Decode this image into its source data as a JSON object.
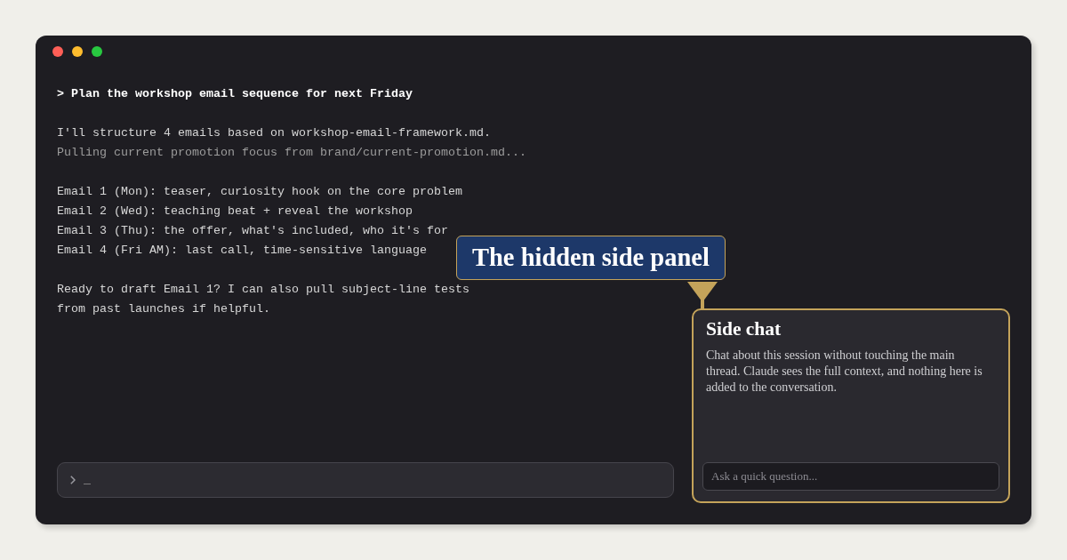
{
  "window": {
    "controls": [
      {
        "color": "#ff5f57"
      },
      {
        "color": "#febc2e"
      },
      {
        "color": "#28c840"
      }
    ]
  },
  "terminal": {
    "prompt": "> Plan the workshop email sequence for next Friday",
    "blocks": [
      [
        {
          "kind": "normal",
          "text": "I'll structure 4 emails based on workshop-email-framework.md."
        },
        {
          "kind": "muted",
          "text": "Pulling current promotion focus from brand/current-promotion.md..."
        }
      ],
      [
        {
          "kind": "normal",
          "text": "Email 1 (Mon): teaser, curiosity hook on the core problem"
        },
        {
          "kind": "normal",
          "text": "Email 2 (Wed): teaching beat + reveal the workshop"
        },
        {
          "kind": "normal",
          "text": "Email 3 (Thu): the offer, what's included, who it's for"
        },
        {
          "kind": "normal",
          "text": "Email 4 (Fri AM): last call, time-sensitive language"
        }
      ],
      [
        {
          "kind": "normal",
          "text": "Ready to draft Email 1? I can also pull subject-line tests"
        },
        {
          "kind": "normal",
          "text": "from past launches if helpful."
        }
      ]
    ],
    "input": {
      "value": "_"
    }
  },
  "callout": {
    "label": "The hidden side panel"
  },
  "side_panel": {
    "title": "Side chat",
    "description": "Chat about this session without touching the main thread. Claude sees the full context, and nothing here is added to the conversation.",
    "input": {
      "placeholder": "Ask a quick question..."
    }
  }
}
